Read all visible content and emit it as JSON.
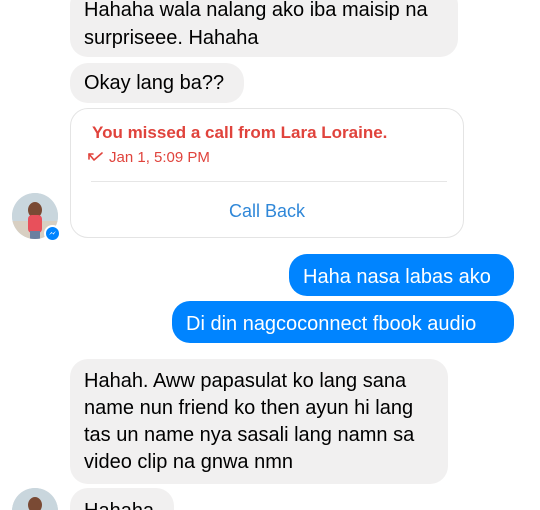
{
  "colors": {
    "incoming_bubble": "#f1f0f0",
    "outgoing_bubble": "#0084ff",
    "missed_call_red": "#e0433c",
    "call_back_blue": "#2f87d8"
  },
  "messages": [
    {
      "direction": "incoming",
      "lines": [
        "Hahaha wala nalang ako iba maisip na",
        "surpriseee. Hahaha"
      ]
    },
    {
      "direction": "incoming",
      "lines": [
        "Okay lang ba??"
      ]
    },
    {
      "direction": "outgoing",
      "lines": [
        "Haha nasa labas ako"
      ]
    },
    {
      "direction": "outgoing",
      "lines": [
        "Di din nagcoconnect fbook audio"
      ]
    },
    {
      "direction": "incoming",
      "lines": [
        "Hahah. Aww papasulat ko lang sana",
        "name nun friend ko then ayun hi lang",
        "tas un name nya sasali lang namn sa",
        "video clip na gnwa nmn"
      ]
    },
    {
      "direction": "incoming",
      "lines": [
        "Hahaha"
      ]
    }
  ],
  "missed_call": {
    "title": "You missed a call from Lara Loraine.",
    "time": "Jan 1, 5:09 PM",
    "icon": "missed-call-arrow-icon",
    "action_label": "Call Back"
  },
  "avatar": {
    "icon": "contact-avatar",
    "badge_icon": "messenger-badge-icon"
  }
}
